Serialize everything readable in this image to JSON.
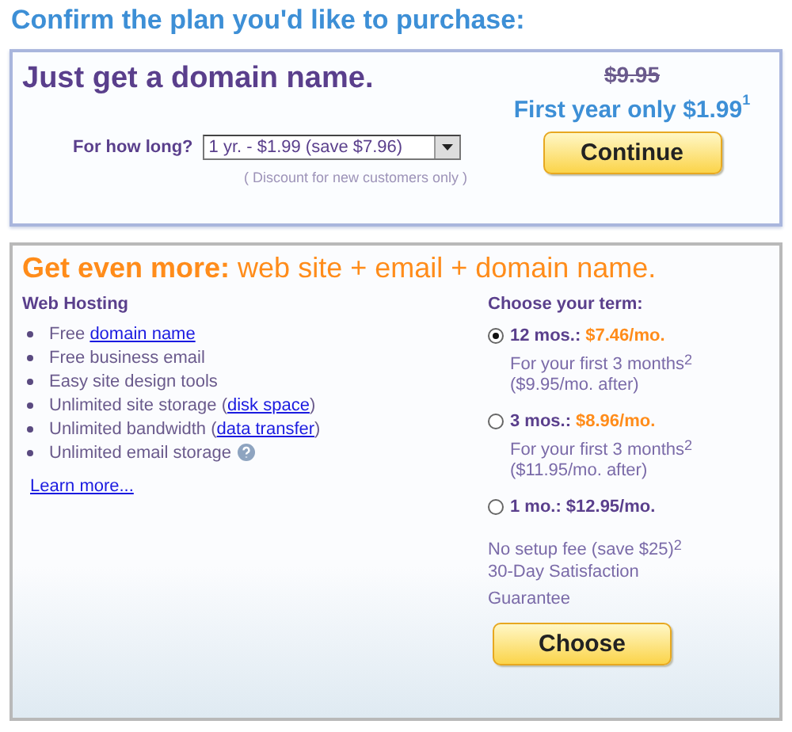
{
  "title": "Confirm the plan you'd like to purchase:",
  "domain_plan": {
    "heading": "Just get a domain name.",
    "old_price": "$9.95",
    "offer": "First year only $1.99$^{1}$",
    "duration_label": "For how long?",
    "duration_value": "1 yr. - $1.99 (save $7.96)",
    "discount_note": "( Discount for new customers only )",
    "button": "Continue"
  },
  "bundle_plan": {
    "heading": "**Get even more:** web site + email + domain name.",
    "features_title": "Web Hosting",
    "features": [
      {
        "text": "Free ",
        "link": "domain name"
      },
      {
        "text": "Free business email"
      },
      {
        "text": "Easy site design tools"
      },
      {
        "text": "Unlimited site storage (",
        "link": "disk space",
        "suffix": ")"
      },
      {
        "text": "Unlimited bandwidth (",
        "link": "data transfer",
        "suffix": ")"
      },
      {
        "text": "Unlimited email storage",
        "help": true
      }
    ],
    "learn_more": "Learn more...",
    "term_title": "Choose your term:",
    "terms": [
      {
        "label": "12 mos.:",
        "price": "$7.46/mo.",
        "highlight": true,
        "selected": true,
        "notes": [
          "For your first 3 months$^{2}$",
          "($9.95/mo. after)"
        ]
      },
      {
        "label": "3 mos.:",
        "price": "$8.96/mo.",
        "highlight": true,
        "selected": false,
        "notes": [
          "For your first 3 months$^{2}$",
          "($11.95/mo. after)"
        ]
      },
      {
        "label": "1 mo.:",
        "price": "$12.95/mo.",
        "highlight": false,
        "selected": false
      }
    ],
    "extras": [
      "No setup fee (save $25)$^{2}$",
      "30-Day Satisfaction",
      "Guarantee"
    ],
    "button": "Choose"
  }
}
